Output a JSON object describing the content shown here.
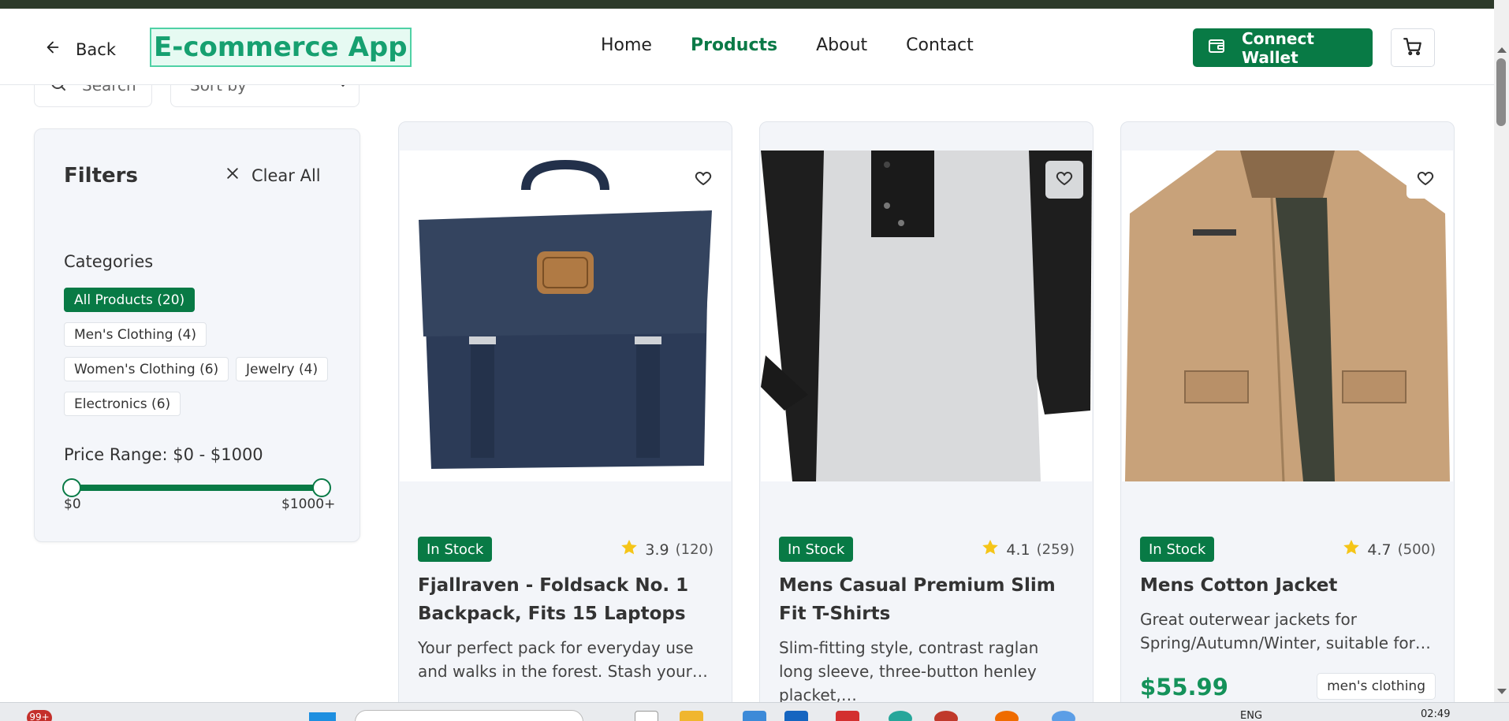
{
  "header": {
    "back_label": "Back",
    "app_title": "E-commerce App",
    "nav": [
      "Home",
      "Products",
      "About",
      "Contact"
    ],
    "active_nav": "Products",
    "wallet_label": "Connect Wallet"
  },
  "toolbar": {
    "search_placeholder": "Search",
    "sort_label": "Sort by"
  },
  "filters": {
    "title": "Filters",
    "clear_all": "Clear All",
    "categories_title": "Categories",
    "categories": [
      "All Products (20)",
      "Men's Clothing (4)",
      "Women's Clothing (6)",
      "Jewelry (4)",
      "Electronics (6)"
    ],
    "active_category": "All Products (20)",
    "price_range_label": "Price Range: $0 - $1000",
    "price_min_label": "$0",
    "price_max_label": "$1000+",
    "price_range_values": [
      0,
      1000
    ]
  },
  "products": [
    {
      "stock": "In Stock",
      "rating": "3.9",
      "reviews": "(120)",
      "title": "Fjallraven - Foldsack No. 1 Backpack, Fits 15 Laptops",
      "description": "Your perfect pack for everyday use and walks in the forest. Stash your…",
      "image_icon": "backpack-image"
    },
    {
      "stock": "In Stock",
      "rating": "4.1",
      "reviews": "(259)",
      "title": "Mens Casual Premium Slim Fit T-Shirts",
      "description": "Slim-fitting style, contrast raglan long sleeve, three-button henley placket,…",
      "image_icon": "tshirt-image"
    },
    {
      "stock": "In Stock",
      "rating": "4.7",
      "reviews": "(500)",
      "title": "Mens Cotton Jacket",
      "description": "Great outerwear jackets for Spring/Autumn/Winter, suitable for…",
      "price": "$55.99",
      "category": "men's clothing",
      "image_icon": "jacket-image"
    }
  ],
  "taskbar": {
    "notification_badge": "99+",
    "language": "ENG",
    "time": "02:49"
  },
  "colors": {
    "brand_green": "#087a45",
    "price_green": "#14925a",
    "logo_green": "#16a070",
    "star_yellow": "#f5c518"
  }
}
